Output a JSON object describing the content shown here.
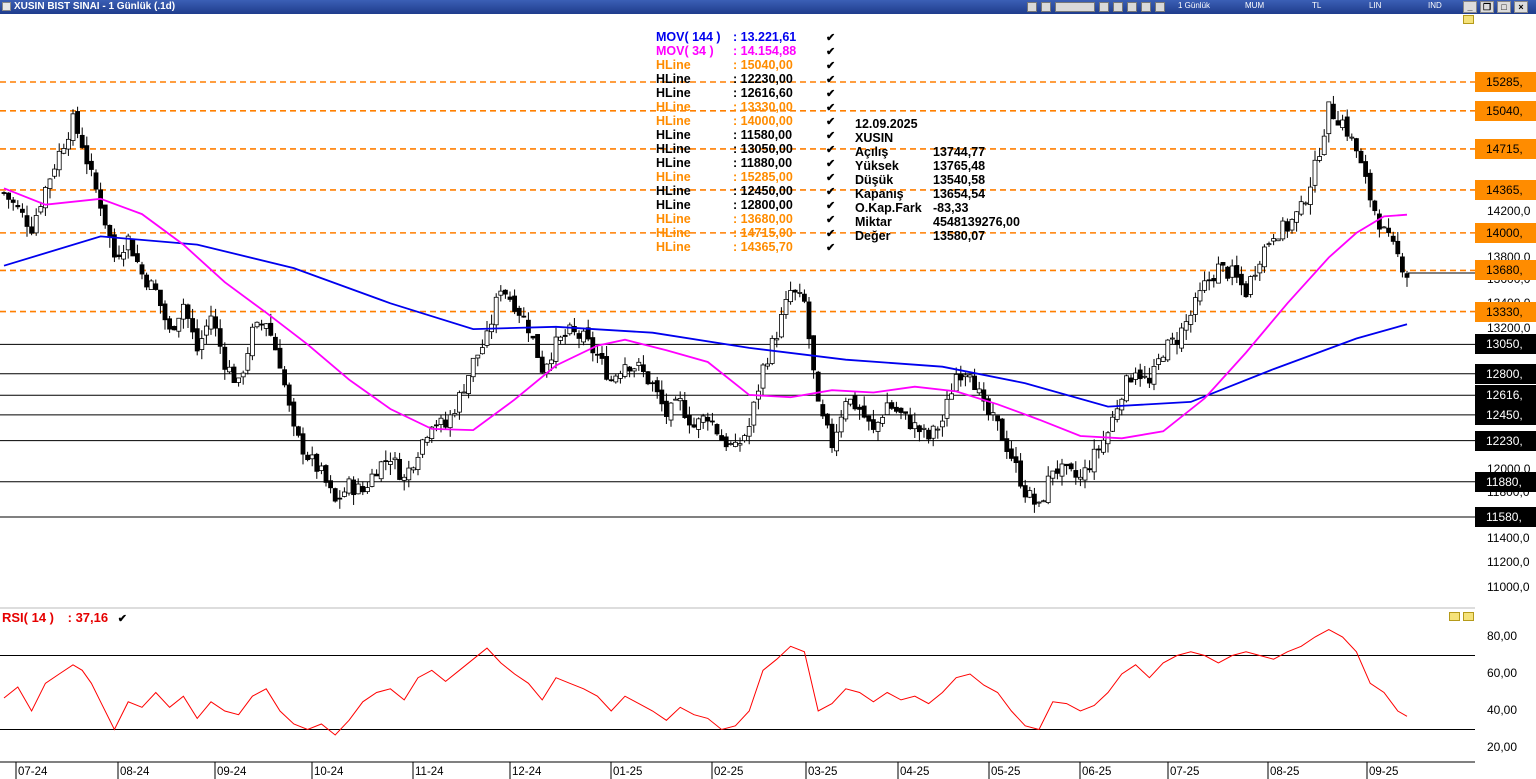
{
  "window": {
    "title": "XUSIN BIST SINAI - 1 Günlük (.1d)",
    "period": "1 Günlük",
    "chart_mode": "MUM",
    "currency": "TL",
    "scale": "LIN",
    "indicator": "IND"
  },
  "legend": {
    "mov144": {
      "label": "MOV( 144 )",
      "value": ": 13.221,61",
      "color": "#0000ee"
    },
    "mov34": {
      "label": "MOV( 34 )",
      "value": ": 14.154,88",
      "color": "#ff00ff"
    },
    "hlines": [
      {
        "label": "HLine",
        "value": ": 15040,00",
        "color": "orange"
      },
      {
        "label": "HLine",
        "value": ": 12230,00",
        "color": "black"
      },
      {
        "label": "HLine",
        "value": ": 12616,60",
        "color": "black"
      },
      {
        "label": "HLine",
        "value": ": 13330,00",
        "color": "orange"
      },
      {
        "label": "HLine",
        "value": ": 14000,00",
        "color": "orange"
      },
      {
        "label": "HLine",
        "value": ": 11580,00",
        "color": "black"
      },
      {
        "label": "HLine",
        "value": ": 13050,00",
        "color": "black"
      },
      {
        "label": "HLine",
        "value": ": 11880,00",
        "color": "black"
      },
      {
        "label": "HLine",
        "value": ": 15285,00",
        "color": "orange"
      },
      {
        "label": "HLine",
        "value": ": 12450,00",
        "color": "black"
      },
      {
        "label": "HLine",
        "value": ": 12800,00",
        "color": "black"
      },
      {
        "label": "HLine",
        "value": ": 13680,00",
        "color": "orange"
      },
      {
        "label": "HLine",
        "value": ": 14715,00",
        "color": "orange"
      },
      {
        "label": "HLine",
        "value": ": 14365,70",
        "color": "orange"
      }
    ],
    "checkmark": "✔"
  },
  "info_panel": {
    "date": "12.09.2025",
    "symbol": "XUSIN",
    "rows": [
      {
        "label": "Açılış",
        "value": "13744,77"
      },
      {
        "label": "Yüksek",
        "value": "13765,48"
      },
      {
        "label": "Düşük",
        "value": "13540,58"
      },
      {
        "label": "Kapanış",
        "value": "13654,54"
      },
      {
        "label": "O.Kap.Fark",
        "value": "-83,33"
      },
      {
        "label": "Miktar",
        "value": "4548139276,00"
      },
      {
        "label": "Değer",
        "value": "13580,07"
      }
    ]
  },
  "price_axis": {
    "ticks": [
      "14200,0",
      "13800,0",
      "13600,0",
      "13400,0",
      "13200,0",
      "12000,0",
      "11800,0",
      "11400,0",
      "11200,0",
      "11000,0"
    ],
    "tags": [
      {
        "text": "15285,",
        "value": 15285,
        "style": "orange"
      },
      {
        "text": "15040,",
        "value": 15040,
        "style": "orange"
      },
      {
        "text": "14715,",
        "value": 14715,
        "style": "orange"
      },
      {
        "text": "14365,",
        "value": 14365,
        "style": "orange"
      },
      {
        "text": "14000,",
        "value": 14000,
        "style": "orange"
      },
      {
        "text": "13680,",
        "value": 13680,
        "style": "orange"
      },
      {
        "text": "13330,",
        "value": 13330,
        "style": "orange"
      },
      {
        "text": "13050,",
        "value": 13050,
        "style": "black"
      },
      {
        "text": "12800,",
        "value": 12800,
        "style": "black"
      },
      {
        "text": "12616,",
        "value": 12616.6,
        "style": "black"
      },
      {
        "text": "12450,",
        "value": 12450,
        "style": "black"
      },
      {
        "text": "12230,",
        "value": 12230,
        "style": "black"
      },
      {
        "text": "11880,",
        "value": 11880,
        "style": "black"
      },
      {
        "text": "11580,",
        "value": 11580,
        "style": "black"
      }
    ]
  },
  "time_axis": [
    "07-24",
    "08-24",
    "09-24",
    "10-24",
    "11-24",
    "12-24",
    "01-25",
    "02-25",
    "03-25",
    "04-25",
    "05-25",
    "06-25",
    "07-25",
    "08-25",
    "09-25"
  ],
  "rsi": {
    "title": "RSI( 14 )",
    "value": ": 37,16",
    "color": "#e60000",
    "levels": [
      70,
      30
    ],
    "ticks": [
      "80,00",
      "60,00",
      "40,00",
      "20,00"
    ]
  },
  "chart_data": {
    "type": "candlestick",
    "symbol": "XUSIN",
    "ylim": [
      10850,
      15500
    ],
    "hlines_orange": [
      15285,
      15040,
      14715,
      14365.7,
      14000,
      13680,
      13330
    ],
    "hlines_black": [
      13050,
      12800,
      12616.6,
      12450,
      12230,
      11880,
      11580
    ],
    "close_path": [
      [
        0,
        14340
      ],
      [
        3,
        14200
      ],
      [
        6,
        14050
      ],
      [
        9,
        14380
      ],
      [
        12,
        14680
      ],
      [
        15,
        14950
      ],
      [
        17,
        14760
      ],
      [
        19,
        14480
      ],
      [
        21,
        14250
      ],
      [
        24,
        13800
      ],
      [
        27,
        13950
      ],
      [
        30,
        13650
      ],
      [
        33,
        13500
      ],
      [
        36,
        13150
      ],
      [
        39,
        13400
      ],
      [
        42,
        13000
      ],
      [
        45,
        13300
      ],
      [
        48,
        12900
      ],
      [
        51,
        12700
      ],
      [
        54,
        13150
      ],
      [
        57,
        13250
      ],
      [
        60,
        12900
      ],
      [
        63,
        12300
      ],
      [
        66,
        12100
      ],
      [
        69,
        11950
      ],
      [
        72,
        11700
      ],
      [
        75,
        11850
      ],
      [
        78,
        11800
      ],
      [
        81,
        12000
      ],
      [
        84,
        12100
      ],
      [
        87,
        11900
      ],
      [
        90,
        12150
      ],
      [
        93,
        12400
      ],
      [
        96,
        12350
      ],
      [
        99,
        12600
      ],
      [
        102,
        12900
      ],
      [
        105,
        13100
      ],
      [
        108,
        13550
      ],
      [
        111,
        13400
      ],
      [
        114,
        13200
      ],
      [
        117,
        12850
      ],
      [
        120,
        13050
      ],
      [
        123,
        13150
      ],
      [
        126,
        13100
      ],
      [
        129,
        12950
      ],
      [
        132,
        12750
      ],
      [
        135,
        12900
      ],
      [
        138,
        12850
      ],
      [
        141,
        12700
      ],
      [
        144,
        12450
      ],
      [
        147,
        12550
      ],
      [
        150,
        12350
      ],
      [
        153,
        12450
      ],
      [
        156,
        12250
      ],
      [
        159,
        12150
      ],
      [
        162,
        12350
      ],
      [
        165,
        12850
      ],
      [
        168,
        13150
      ],
      [
        171,
        13500
      ],
      [
        174,
        13400
      ],
      [
        177,
        12500
      ],
      [
        180,
        12200
      ],
      [
        183,
        12600
      ],
      [
        186,
        12500
      ],
      [
        189,
        12300
      ],
      [
        192,
        12550
      ],
      [
        195,
        12450
      ],
      [
        198,
        12350
      ],
      [
        201,
        12250
      ],
      [
        204,
        12400
      ],
      [
        207,
        12800
      ],
      [
        210,
        12850
      ],
      [
        213,
        12500
      ],
      [
        216,
        12350
      ],
      [
        219,
        12100
      ],
      [
        222,
        11800
      ],
      [
        225,
        11650
      ],
      [
        228,
        12000
      ],
      [
        231,
        11950
      ],
      [
        234,
        11900
      ],
      [
        237,
        12100
      ],
      [
        240,
        12300
      ],
      [
        243,
        12650
      ],
      [
        246,
        12850
      ],
      [
        249,
        12700
      ],
      [
        252,
        13000
      ],
      [
        255,
        13100
      ],
      [
        258,
        13300
      ],
      [
        261,
        13550
      ],
      [
        264,
        13700
      ],
      [
        267,
        13650
      ],
      [
        270,
        13500
      ],
      [
        273,
        13800
      ],
      [
        276,
        14000
      ],
      [
        279,
        14050
      ],
      [
        282,
        14200
      ],
      [
        285,
        14550
      ],
      [
        288,
        15050
      ],
      [
        291,
        14950
      ],
      [
        294,
        14700
      ],
      [
        297,
        14300
      ],
      [
        300,
        14000
      ],
      [
        303,
        13800
      ],
      [
        305,
        13654.54
      ]
    ],
    "mov144_path": [
      [
        0,
        13720
      ],
      [
        21,
        13970
      ],
      [
        42,
        13900
      ],
      [
        63,
        13700
      ],
      [
        84,
        13400
      ],
      [
        102,
        13180
      ],
      [
        120,
        13200
      ],
      [
        141,
        13150
      ],
      [
        162,
        13020
      ],
      [
        183,
        12920
      ],
      [
        204,
        12860
      ],
      [
        222,
        12720
      ],
      [
        240,
        12520
      ],
      [
        258,
        12560
      ],
      [
        276,
        12840
      ],
      [
        294,
        13100
      ],
      [
        305,
        13221.61
      ]
    ],
    "mov34_path": [
      [
        0,
        14380
      ],
      [
        9,
        14240
      ],
      [
        21,
        14290
      ],
      [
        30,
        14160
      ],
      [
        39,
        13900
      ],
      [
        48,
        13580
      ],
      [
        57,
        13320
      ],
      [
        66,
        13050
      ],
      [
        75,
        12750
      ],
      [
        84,
        12500
      ],
      [
        93,
        12330
      ],
      [
        102,
        12320
      ],
      [
        111,
        12580
      ],
      [
        120,
        12870
      ],
      [
        129,
        13040
      ],
      [
        135,
        13090
      ],
      [
        144,
        13000
      ],
      [
        153,
        12900
      ],
      [
        162,
        12620
      ],
      [
        171,
        12600
      ],
      [
        180,
        12660
      ],
      [
        189,
        12640
      ],
      [
        198,
        12690
      ],
      [
        207,
        12650
      ],
      [
        216,
        12540
      ],
      [
        225,
        12410
      ],
      [
        234,
        12270
      ],
      [
        243,
        12250
      ],
      [
        252,
        12310
      ],
      [
        261,
        12590
      ],
      [
        270,
        12980
      ],
      [
        279,
        13400
      ],
      [
        288,
        13790
      ],
      [
        294,
        14000
      ],
      [
        300,
        14140
      ],
      [
        305,
        14154.88
      ]
    ],
    "rsi_path": [
      [
        0,
        47
      ],
      [
        3,
        53
      ],
      [
        6,
        40
      ],
      [
        9,
        55
      ],
      [
        12,
        60
      ],
      [
        15,
        65
      ],
      [
        17,
        62
      ],
      [
        19,
        55
      ],
      [
        21,
        45
      ],
      [
        24,
        30
      ],
      [
        27,
        45
      ],
      [
        30,
        42
      ],
      [
        33,
        50
      ],
      [
        36,
        42
      ],
      [
        39,
        48
      ],
      [
        42,
        36
      ],
      [
        45,
        45
      ],
      [
        48,
        40
      ],
      [
        51,
        38
      ],
      [
        54,
        48
      ],
      [
        57,
        52
      ],
      [
        60,
        40
      ],
      [
        63,
        33
      ],
      [
        66,
        30
      ],
      [
        69,
        33
      ],
      [
        72,
        27
      ],
      [
        75,
        35
      ],
      [
        78,
        45
      ],
      [
        81,
        50
      ],
      [
        84,
        52
      ],
      [
        87,
        46
      ],
      [
        90,
        58
      ],
      [
        93,
        62
      ],
      [
        96,
        56
      ],
      [
        99,
        62
      ],
      [
        102,
        68
      ],
      [
        105,
        74
      ],
      [
        108,
        66
      ],
      [
        111,
        60
      ],
      [
        114,
        55
      ],
      [
        117,
        46
      ],
      [
        120,
        58
      ],
      [
        123,
        55
      ],
      [
        126,
        52
      ],
      [
        129,
        48
      ],
      [
        132,
        40
      ],
      [
        135,
        48
      ],
      [
        138,
        44
      ],
      [
        141,
        40
      ],
      [
        144,
        35
      ],
      [
        147,
        42
      ],
      [
        150,
        38
      ],
      [
        153,
        36
      ],
      [
        156,
        30
      ],
      [
        159,
        32
      ],
      [
        162,
        40
      ],
      [
        165,
        62
      ],
      [
        168,
        68
      ],
      [
        171,
        75
      ],
      [
        174,
        72
      ],
      [
        177,
        40
      ],
      [
        180,
        44
      ],
      [
        183,
        52
      ],
      [
        186,
        50
      ],
      [
        189,
        45
      ],
      [
        192,
        50
      ],
      [
        195,
        46
      ],
      [
        198,
        48
      ],
      [
        201,
        44
      ],
      [
        204,
        50
      ],
      [
        207,
        58
      ],
      [
        210,
        60
      ],
      [
        213,
        54
      ],
      [
        216,
        50
      ],
      [
        219,
        40
      ],
      [
        222,
        32
      ],
      [
        225,
        30
      ],
      [
        228,
        45
      ],
      [
        231,
        44
      ],
      [
        234,
        40
      ],
      [
        237,
        43
      ],
      [
        240,
        50
      ],
      [
        243,
        60
      ],
      [
        246,
        65
      ],
      [
        249,
        58
      ],
      [
        252,
        66
      ],
      [
        255,
        70
      ],
      [
        258,
        72
      ],
      [
        261,
        70
      ],
      [
        264,
        66
      ],
      [
        267,
        70
      ],
      [
        270,
        72
      ],
      [
        273,
        70
      ],
      [
        276,
        68
      ],
      [
        279,
        72
      ],
      [
        282,
        75
      ],
      [
        285,
        80
      ],
      [
        288,
        84
      ],
      [
        291,
        80
      ],
      [
        294,
        72
      ],
      [
        297,
        55
      ],
      [
        300,
        50
      ],
      [
        303,
        40
      ],
      [
        305,
        37.16
      ]
    ]
  }
}
